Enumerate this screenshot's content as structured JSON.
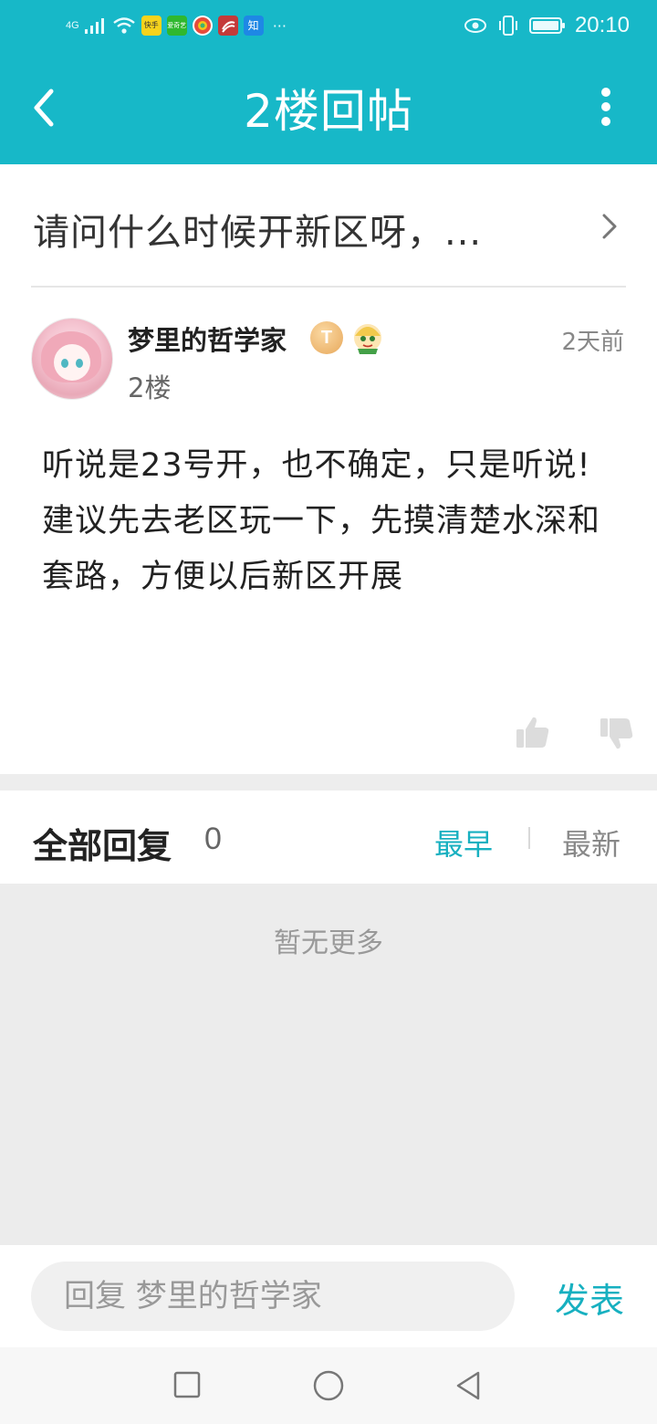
{
  "status_bar": {
    "network": "4G",
    "app_icons": [
      "快手",
      "爱奇艺",
      "微博",
      "新闻",
      "知"
    ],
    "more": "···",
    "time": "20:10"
  },
  "header": {
    "title": "2楼回帖"
  },
  "thread": {
    "title": "请问什么时候开新区呀，..."
  },
  "post": {
    "username": "梦里的哲学家",
    "badge_letter": "T",
    "time_ago": "2天前",
    "floor": "2楼",
    "body_line1": "听说是23号开，也不确定，只是听说!",
    "body_line2": "建议先去老区玩一下，先摸清楚水深和套路，方便以后新区开展"
  },
  "replies": {
    "title": "全部回复",
    "count": "0",
    "sort_earliest": "最早",
    "sort_latest": "最新",
    "empty_text": "暂无更多"
  },
  "reply_bar": {
    "placeholder": "回复 梦里的哲学家",
    "send_label": "发表"
  },
  "colors": {
    "accent": "#17b8c8",
    "accent_text": "#17b0c0"
  }
}
